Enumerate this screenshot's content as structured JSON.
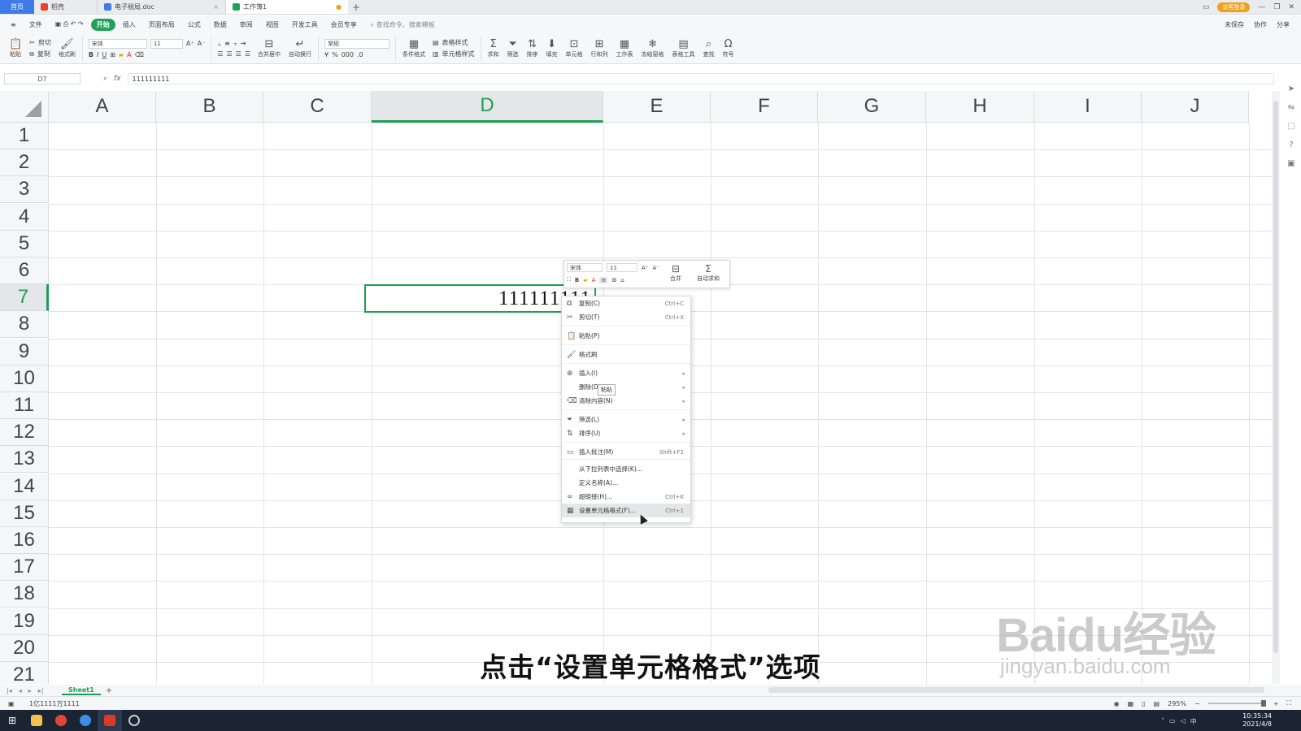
{
  "titlebar": {
    "tabs": [
      {
        "label": "首页"
      },
      {
        "label": "稻壳"
      },
      {
        "label": "电子税局.doc"
      },
      {
        "label": "工作簿1"
      }
    ],
    "login_label": "访客登录"
  },
  "menubar": {
    "file_label": "文件",
    "items": [
      "开始",
      "插入",
      "页面布局",
      "公式",
      "数据",
      "审阅",
      "视图",
      "开发工具",
      "会员专享"
    ],
    "search_placeholder": "查找命令、搜索模板",
    "right": [
      "未保存",
      "协作",
      "分享"
    ]
  },
  "ribbon": {
    "paste": "粘贴",
    "cut": "剪切",
    "copy": "复制",
    "format_painter": "格式刷",
    "font_name": "宋体",
    "font_size": "11",
    "merge_center": "合并居中",
    "wrap_text": "自动换行",
    "number_format": "常规",
    "conditional_format": "条件格式",
    "table_style": "表格样式",
    "cell_style": "单元格样式",
    "sum": "求和",
    "filter": "筛选",
    "sort": "排序",
    "fill": "填充",
    "cell": "单元格",
    "row_col": "行和列",
    "worksheet": "工作表",
    "freeze": "冻结窗格",
    "table_tools": "表格工具",
    "find": "查找",
    "symbol": "符号"
  },
  "formula": {
    "cell_ref": "D7",
    "fx": "fx",
    "content": "111111111"
  },
  "grid": {
    "columns": [
      "A",
      "B",
      "C",
      "D",
      "E",
      "F",
      "G",
      "H",
      "I",
      "J"
    ],
    "rows": [
      "1",
      "2",
      "3",
      "4",
      "5",
      "6",
      "7",
      "8",
      "9",
      "10",
      "11",
      "12",
      "13",
      "14",
      "15",
      "16",
      "17",
      "18",
      "19",
      "20",
      "21"
    ],
    "active_column": "D",
    "active_row": "7",
    "active_value": "111111111"
  },
  "mini_toolbar": {
    "font_name": "宋体",
    "font_size": "11",
    "merge": "合并",
    "autosum": "自动求和"
  },
  "context_menu": {
    "items": [
      {
        "label": "复制(C)",
        "shortcut": "Ctrl+C",
        "icon": "copy-icon"
      },
      {
        "label": "剪切(T)",
        "shortcut": "Ctrl+X",
        "icon": "cut-icon"
      },
      {
        "label": "粘贴(P)",
        "shortcut": "",
        "icon": "paste-icon"
      },
      {
        "label": "格式刷",
        "shortcut": "",
        "icon": "format-painter-icon"
      },
      {
        "label": "插入(I)",
        "shortcut": "",
        "icon": "insert-icon",
        "submenu": true
      },
      {
        "label": "删除(D)",
        "shortcut": "",
        "icon": "",
        "submenu": true
      },
      {
        "label": "清除内容(N)",
        "shortcut": "",
        "icon": "eraser-icon",
        "submenu": true
      },
      {
        "label": "筛选(L)",
        "shortcut": "",
        "icon": "filter-icon",
        "submenu": true
      },
      {
        "label": "排序(U)",
        "shortcut": "",
        "icon": "sort-icon",
        "submenu": true
      },
      {
        "label": "插入批注(M)",
        "shortcut": "Shift+F2",
        "icon": "comment-icon"
      },
      {
        "label": "从下拉列表中选择(K)...",
        "shortcut": "",
        "icon": ""
      },
      {
        "label": "定义名称(A)...",
        "shortcut": "",
        "icon": ""
      },
      {
        "label": "超链接(H)...",
        "shortcut": "Ctrl+K",
        "icon": "link-icon"
      },
      {
        "label": "设置单元格格式(F)...",
        "shortcut": "Ctrl+1",
        "icon": "format-cells-icon"
      }
    ],
    "tooltip": "粘贴"
  },
  "sheets": {
    "tabs": [
      "Sheet1"
    ]
  },
  "status": {
    "left": "1亿1111万1111",
    "zoom": "295%"
  },
  "taskbar": {
    "time": "10:35:34",
    "date": "2021/4/8"
  },
  "subtitle": "点击“设置单元格格式”选项",
  "watermark": {
    "logo": "Baidu经验",
    "url": "jingyan.baidu.com"
  },
  "colors": {
    "accent_green": "#1e9e55",
    "tab_blue": "#3f7be6",
    "taskbar": "#1a2433"
  }
}
